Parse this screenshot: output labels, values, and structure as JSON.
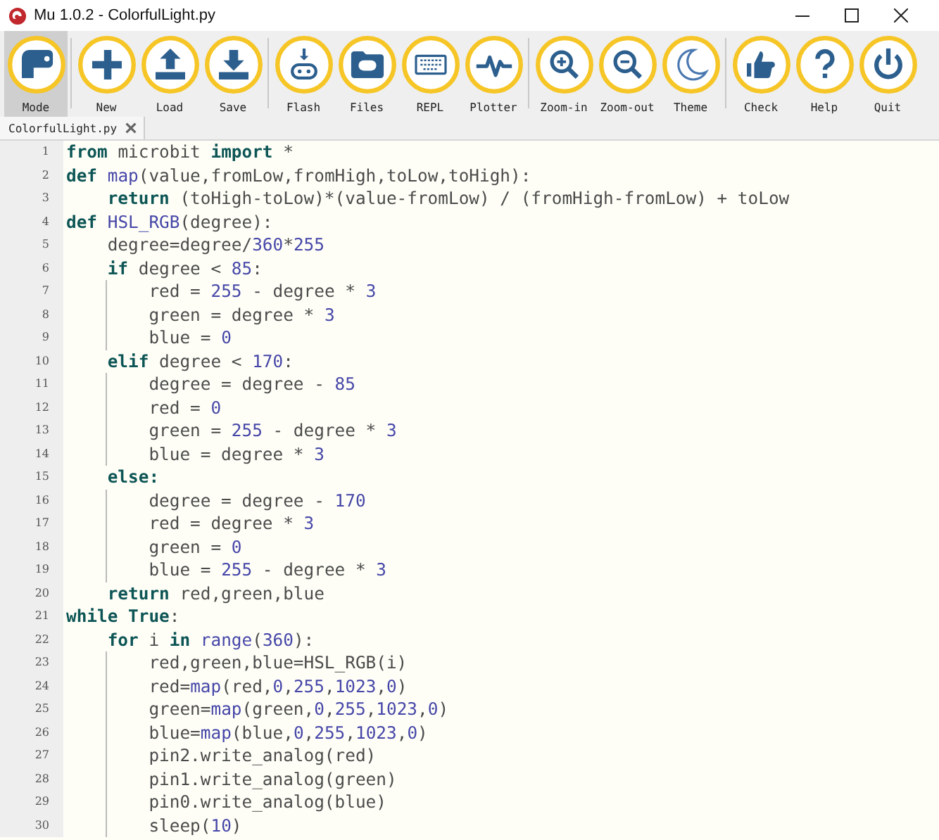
{
  "window": {
    "title": "Mu 1.0.2 - ColorfulLight.py"
  },
  "toolbar_groups": [
    [
      {
        "label": "Mode",
        "selected": true
      }
    ],
    [
      {
        "label": "New",
        "selected": false
      },
      {
        "label": "Load",
        "selected": false
      },
      {
        "label": "Save",
        "selected": false
      }
    ],
    [
      {
        "label": "Flash",
        "selected": false
      },
      {
        "label": "Files",
        "selected": false
      },
      {
        "label": "REPL",
        "selected": false
      },
      {
        "label": "Plotter",
        "selected": false
      }
    ],
    [
      {
        "label": "Zoom-in",
        "selected": false
      },
      {
        "label": "Zoom-out",
        "selected": false
      },
      {
        "label": "Theme",
        "selected": false
      }
    ],
    [
      {
        "label": "Check",
        "selected": false
      },
      {
        "label": "Help",
        "selected": false
      },
      {
        "label": "Quit",
        "selected": false
      }
    ]
  ],
  "tabs": [
    {
      "label": "ColorfulLight.py",
      "selected": true
    }
  ],
  "editor": {
    "lines": [
      {
        "number": "1",
        "tokens": [
          {
            "kind": "kw",
            "text": "from"
          },
          {
            "kind": "text",
            "text": " microbit "
          },
          {
            "kind": "kw",
            "text": "import"
          },
          {
            "kind": "text",
            "text": " *"
          }
        ]
      },
      {
        "number": "2",
        "tokens": [
          {
            "kind": "kw",
            "text": "def"
          },
          {
            "kind": "lit",
            "text": " map"
          },
          {
            "kind": "text",
            "text": "(value,fromLow,fromHigh,toLow,toHigh):"
          }
        ]
      },
      {
        "number": "3",
        "tokens": [
          {
            "kind": "kw",
            "text": "    return"
          },
          {
            "kind": "text",
            "text": " (toHigh-toLow)*(value-fromLow) / (fromHigh-fromLow) + toLow"
          }
        ]
      },
      {
        "number": "4",
        "tokens": [
          {
            "kind": "kw",
            "text": "def"
          },
          {
            "kind": "lit",
            "text": " HSL_RGB"
          },
          {
            "kind": "text",
            "text": "(degree):"
          }
        ]
      },
      {
        "number": "5",
        "tokens": [
          {
            "kind": "text",
            "text": "    degree=degree/"
          },
          {
            "kind": "lit",
            "text": "360"
          },
          {
            "kind": "text",
            "text": "*"
          },
          {
            "kind": "lit",
            "text": "255"
          }
        ]
      },
      {
        "number": "6",
        "tokens": [
          {
            "kind": "kw",
            "text": "    if"
          },
          {
            "kind": "text",
            "text": " degree < "
          },
          {
            "kind": "lit",
            "text": "85"
          },
          {
            "kind": "text",
            "text": ":"
          }
        ]
      },
      {
        "number": "7",
        "tokens": [
          {
            "kind": "text",
            "text": "        red = "
          },
          {
            "kind": "lit",
            "text": "255"
          },
          {
            "kind": "text",
            "text": " - degree * "
          },
          {
            "kind": "lit",
            "text": "3"
          }
        ]
      },
      {
        "number": "8",
        "tokens": [
          {
            "kind": "text",
            "text": "        green = degree * "
          },
          {
            "kind": "lit",
            "text": "3"
          }
        ]
      },
      {
        "number": "9",
        "tokens": [
          {
            "kind": "text",
            "text": "        blue = "
          },
          {
            "kind": "lit",
            "text": "0"
          }
        ]
      },
      {
        "number": "10",
        "tokens": [
          {
            "kind": "kw",
            "text": "    elif"
          },
          {
            "kind": "text",
            "text": " degree < "
          },
          {
            "kind": "lit",
            "text": "170"
          },
          {
            "kind": "text",
            "text": ":"
          }
        ]
      },
      {
        "number": "11",
        "tokens": [
          {
            "kind": "text",
            "text": "        degree = degree - "
          },
          {
            "kind": "lit",
            "text": "85"
          }
        ]
      },
      {
        "number": "12",
        "tokens": [
          {
            "kind": "text",
            "text": "        red = "
          },
          {
            "kind": "lit",
            "text": "0"
          }
        ]
      },
      {
        "number": "13",
        "tokens": [
          {
            "kind": "text",
            "text": "        green = "
          },
          {
            "kind": "lit",
            "text": "255"
          },
          {
            "kind": "text",
            "text": " - degree * "
          },
          {
            "kind": "lit",
            "text": "3"
          }
        ]
      },
      {
        "number": "14",
        "tokens": [
          {
            "kind": "text",
            "text": "        blue = degree * "
          },
          {
            "kind": "lit",
            "text": "3"
          }
        ]
      },
      {
        "number": "15",
        "tokens": [
          {
            "kind": "kw",
            "text": "    else:"
          }
        ]
      },
      {
        "number": "16",
        "tokens": [
          {
            "kind": "text",
            "text": "        degree = degree - "
          },
          {
            "kind": "lit",
            "text": "170"
          }
        ]
      },
      {
        "number": "17",
        "tokens": [
          {
            "kind": "text",
            "text": "        red = degree * "
          },
          {
            "kind": "lit",
            "text": "3"
          }
        ]
      },
      {
        "number": "18",
        "tokens": [
          {
            "kind": "text",
            "text": "        green = "
          },
          {
            "kind": "lit",
            "text": "0"
          }
        ]
      },
      {
        "number": "19",
        "tokens": [
          {
            "kind": "text",
            "text": "        blue = "
          },
          {
            "kind": "lit",
            "text": "255"
          },
          {
            "kind": "text",
            "text": " - degree * "
          },
          {
            "kind": "lit",
            "text": "3"
          }
        ]
      },
      {
        "number": "20",
        "tokens": [
          {
            "kind": "kw",
            "text": "    return"
          },
          {
            "kind": "text",
            "text": " red,green,blue"
          }
        ]
      },
      {
        "number": "21",
        "tokens": [
          {
            "kind": "kw",
            "text": "while"
          },
          {
            "kind": "kw",
            "text": " True"
          },
          {
            "kind": "text",
            "text": ":"
          }
        ]
      },
      {
        "number": "22",
        "tokens": [
          {
            "kind": "kw",
            "text": "    for"
          },
          {
            "kind": "text",
            "text": " i "
          },
          {
            "kind": "kw",
            "text": "in"
          },
          {
            "kind": "lit",
            "text": " range"
          },
          {
            "kind": "text",
            "text": "("
          },
          {
            "kind": "lit",
            "text": "360"
          },
          {
            "kind": "text",
            "text": "):"
          }
        ]
      },
      {
        "number": "23",
        "tokens": [
          {
            "kind": "text",
            "text": "        red,green,blue=HSL_RGB(i)"
          }
        ]
      },
      {
        "number": "24",
        "tokens": [
          {
            "kind": "text",
            "text": "        red="
          },
          {
            "kind": "lit",
            "text": "map"
          },
          {
            "kind": "text",
            "text": "(red,"
          },
          {
            "kind": "lit",
            "text": "0"
          },
          {
            "kind": "text",
            "text": ","
          },
          {
            "kind": "lit",
            "text": "255"
          },
          {
            "kind": "text",
            "text": ","
          },
          {
            "kind": "lit",
            "text": "1023"
          },
          {
            "kind": "text",
            "text": ","
          },
          {
            "kind": "lit",
            "text": "0"
          },
          {
            "kind": "text",
            "text": ")"
          }
        ]
      },
      {
        "number": "25",
        "tokens": [
          {
            "kind": "text",
            "text": "        green="
          },
          {
            "kind": "lit",
            "text": "map"
          },
          {
            "kind": "text",
            "text": "(green,"
          },
          {
            "kind": "lit",
            "text": "0"
          },
          {
            "kind": "text",
            "text": ","
          },
          {
            "kind": "lit",
            "text": "255"
          },
          {
            "kind": "text",
            "text": ","
          },
          {
            "kind": "lit",
            "text": "1023"
          },
          {
            "kind": "text",
            "text": ","
          },
          {
            "kind": "lit",
            "text": "0"
          },
          {
            "kind": "text",
            "text": ")"
          }
        ]
      },
      {
        "number": "26",
        "tokens": [
          {
            "kind": "text",
            "text": "        blue="
          },
          {
            "kind": "lit",
            "text": "map"
          },
          {
            "kind": "text",
            "text": "(blue,"
          },
          {
            "kind": "lit",
            "text": "0"
          },
          {
            "kind": "text",
            "text": ","
          },
          {
            "kind": "lit",
            "text": "255"
          },
          {
            "kind": "text",
            "text": ","
          },
          {
            "kind": "lit",
            "text": "1023"
          },
          {
            "kind": "text",
            "text": ","
          },
          {
            "kind": "lit",
            "text": "0"
          },
          {
            "kind": "text",
            "text": ")"
          }
        ]
      },
      {
        "number": "27",
        "tokens": [
          {
            "kind": "text",
            "text": "        pin2.write_analog(red)"
          }
        ]
      },
      {
        "number": "28",
        "tokens": [
          {
            "kind": "text",
            "text": "        pin1.write_analog(green)"
          }
        ]
      },
      {
        "number": "29",
        "tokens": [
          {
            "kind": "text",
            "text": "        pin0.write_analog(blue)"
          }
        ]
      },
      {
        "number": "30",
        "tokens": [
          {
            "kind": "text",
            "text": "        sleep("
          },
          {
            "kind": "lit",
            "text": "10"
          },
          {
            "kind": "text",
            "text": ")"
          }
        ]
      }
    ]
  }
}
